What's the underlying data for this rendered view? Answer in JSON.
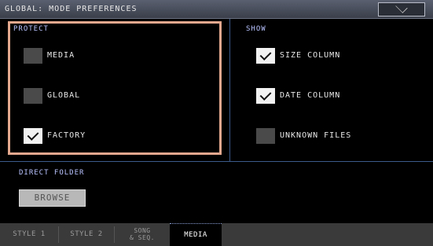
{
  "title": "GLOBAL: MODE PREFERENCES",
  "protect": {
    "label": "PROTECT",
    "items": [
      {
        "label": "MEDIA",
        "checked": false
      },
      {
        "label": "GLOBAL",
        "checked": false
      },
      {
        "label": "FACTORY",
        "checked": true
      }
    ]
  },
  "show": {
    "label": "SHOW",
    "items": [
      {
        "label": "SIZE COLUMN",
        "checked": true
      },
      {
        "label": "DATE COLUMN",
        "checked": true
      },
      {
        "label": "UNKNOWN FILES",
        "checked": false
      }
    ]
  },
  "direct_folder": {
    "label": "DIRECT FOLDER",
    "browse_label": "BROWSE"
  },
  "tabs": [
    {
      "label": "STYLE 1",
      "line1": "",
      "line2": "",
      "active": false
    },
    {
      "label": "STYLE 2",
      "line1": "",
      "line2": "",
      "active": false
    },
    {
      "label": "",
      "line1": "SONG",
      "line2": "& SEQ.",
      "active": false
    },
    {
      "label": "MEDIA",
      "line1": "",
      "line2": "",
      "active": true
    }
  ],
  "colors": {
    "accent_border": "#e4a88e",
    "section_label": "#b9c3ff",
    "divider": "#3c5a8a"
  }
}
